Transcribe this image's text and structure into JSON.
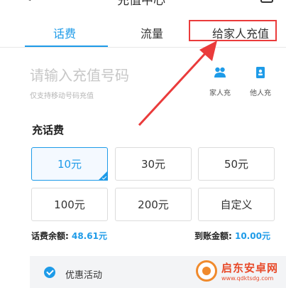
{
  "header": {
    "back_glyph": "<",
    "title": "充值中心"
  },
  "tabs": [
    {
      "label": "话费",
      "active": true
    },
    {
      "label": "流量",
      "active": false
    },
    {
      "label": "给家人充值",
      "active": false
    }
  ],
  "phone": {
    "placeholder": "请输入充值号码",
    "hint": "仅支持移动号码充值"
  },
  "contacts": [
    {
      "label": "家人充",
      "icon": "family-icon"
    },
    {
      "label": "他人充",
      "icon": "contact-book-icon"
    }
  ],
  "recharge": {
    "section_title": "充话费",
    "amounts": [
      "10元",
      "30元",
      "50元",
      "100元",
      "200元",
      "自定义"
    ],
    "selected_index": 0
  },
  "balance": {
    "label": "话费余额: ",
    "value": "48.61元",
    "arrive_label": "到账金额: ",
    "arrive_value": "10.00元"
  },
  "promo": {
    "label": "优惠活动",
    "checked": true
  },
  "watermark": {
    "title": "启东安卓网",
    "url": "www.qdktsdg.com"
  },
  "colors": {
    "accent": "#1e9be8",
    "highlight": "#ea3b3b",
    "watermark": "#e84a2a"
  }
}
